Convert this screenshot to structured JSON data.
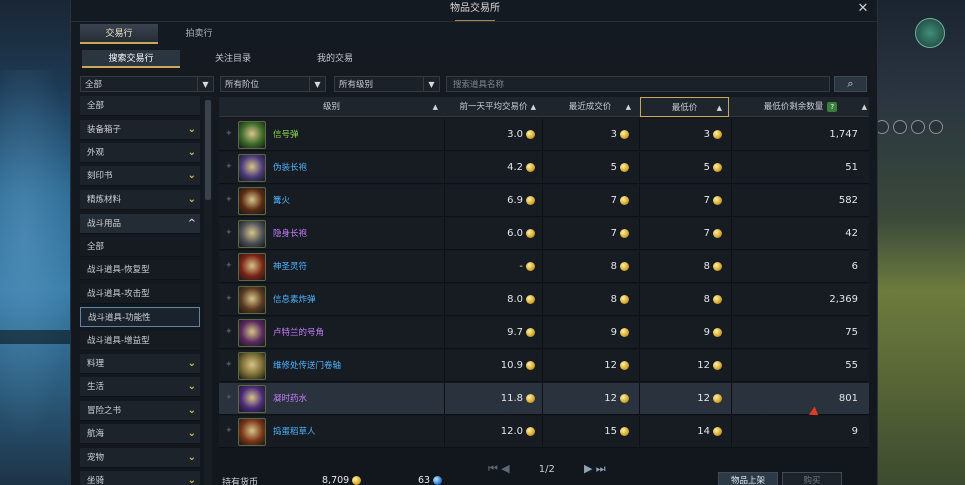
{
  "window": {
    "title": "物品交易所"
  },
  "tabs": [
    {
      "label": "交易行",
      "active": true
    },
    {
      "label": "拍卖行",
      "active": false
    }
  ],
  "subtabs": [
    {
      "label": "搜索交易行",
      "active": true
    },
    {
      "label": "关注目录",
      "active": false
    },
    {
      "label": "我的交易",
      "active": false
    }
  ],
  "filters": {
    "category": "全部",
    "tier": "所有阶位",
    "grade": "所有级别",
    "search_placeholder": "搜索道具名称"
  },
  "categories": [
    {
      "label": "全部",
      "type": "top"
    },
    {
      "label": "装备箱子",
      "type": "group"
    },
    {
      "label": "外观",
      "type": "group"
    },
    {
      "label": "刻印书",
      "type": "group"
    },
    {
      "label": "精炼材料",
      "type": "group"
    },
    {
      "label": "战斗用品",
      "type": "open"
    },
    {
      "label": "全部",
      "type": "sub"
    },
    {
      "label": "战斗道具-恢复型",
      "type": "sub"
    },
    {
      "label": "战斗道具-攻击型",
      "type": "sub"
    },
    {
      "label": "战斗道具-功能性",
      "type": "selected"
    },
    {
      "label": "战斗道具-增益型",
      "type": "sub"
    },
    {
      "label": "料理",
      "type": "group"
    },
    {
      "label": "生活",
      "type": "group"
    },
    {
      "label": "冒险之书",
      "type": "group"
    },
    {
      "label": "航海",
      "type": "group"
    },
    {
      "label": "宠物",
      "type": "group"
    },
    {
      "label": "坐骑",
      "type": "group"
    }
  ],
  "table": {
    "headers": {
      "grade": "级别",
      "avg_price": "前一天平均交易价",
      "recent_price": "最近成交价",
      "lowest_price": "最低价",
      "remaining": "最低价剩余数量",
      "help": "?"
    },
    "rows": [
      {
        "name": "信号弹",
        "name_color": "#8fd64b",
        "icon": "signal-flare-icon",
        "icon_bg": "#3d6b2a",
        "avg": "3.0",
        "recent": "3",
        "lowest": "3",
        "qty": "1,747"
      },
      {
        "name": "伪装长袍",
        "name_color": "#4fb3ff",
        "icon": "disguise-robe-icon",
        "icon_bg": "#4a3a7a",
        "avg": "4.2",
        "recent": "5",
        "lowest": "5",
        "qty": "51"
      },
      {
        "name": "篝火",
        "name_color": "#4fb3ff",
        "icon": "campfire-icon",
        "icon_bg": "#5a2a12",
        "avg": "6.9",
        "recent": "7",
        "lowest": "7",
        "qty": "582"
      },
      {
        "name": "隐身长袍",
        "name_color": "#c77dff",
        "icon": "stealth-robe-icon",
        "icon_bg": "#4e4f58",
        "avg": "6.0",
        "recent": "7",
        "lowest": "7",
        "qty": "42"
      },
      {
        "name": "神圣灵符",
        "name_color": "#4fb3ff",
        "icon": "holy-charm-icon",
        "icon_bg": "#7a2416",
        "avg": "-",
        "recent": "8",
        "lowest": "8",
        "qty": "6"
      },
      {
        "name": "信息素炸弹",
        "name_color": "#4fb3ff",
        "icon": "pheromone-bomb-icon",
        "icon_bg": "#5a3a22",
        "avg": "8.0",
        "recent": "8",
        "lowest": "8",
        "qty": "2,369"
      },
      {
        "name": "卢特兰的号角",
        "name_color": "#c77dff",
        "icon": "horn-icon",
        "icon_bg": "#5a2a5e",
        "avg": "9.7",
        "recent": "9",
        "lowest": "9",
        "qty": "75"
      },
      {
        "name": "维修处传送门卷轴",
        "name_color": "#4fb3ff",
        "icon": "portal-scroll-icon",
        "icon_bg": "#7a6a32",
        "avg": "10.9",
        "recent": "12",
        "lowest": "12",
        "qty": "55"
      },
      {
        "name": "凝时药水",
        "name_color": "#c77dff",
        "icon": "time-potion-icon",
        "icon_bg": "#4a2a7a",
        "avg": "11.8",
        "recent": "12",
        "lowest": "12",
        "qty": "801",
        "selected": true
      },
      {
        "name": "捣蛋稻草人",
        "name_color": "#4fb3ff",
        "icon": "scarecrow-icon",
        "icon_bg": "#7a3618",
        "avg": "12.0",
        "recent": "15",
        "lowest": "14",
        "qty": "9"
      }
    ]
  },
  "pager": {
    "text": "1/2",
    "first": "⏮",
    "prev": "◀",
    "next": "▶",
    "last": "⏭"
  },
  "footer": {
    "currency_label": "持有货币",
    "gold": "8,709",
    "crystal": "63",
    "list_button": "物品上架",
    "buy_button": "购买"
  }
}
